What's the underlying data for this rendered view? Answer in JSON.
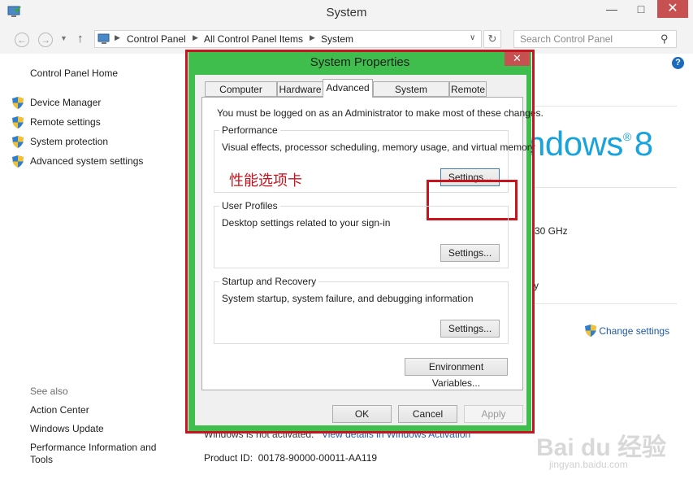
{
  "window": {
    "title": "System"
  },
  "nav": {
    "breadcrumbs": [
      "Control Panel",
      "All Control Panel Items",
      "System"
    ],
    "search_placeholder": "Search Control Panel"
  },
  "sidebar": {
    "home": "Control Panel Home",
    "links": [
      {
        "label": "Device Manager",
        "icon": "shield-icon"
      },
      {
        "label": "Remote settings",
        "icon": "shield-icon"
      },
      {
        "label": "System protection",
        "icon": "shield-icon"
      },
      {
        "label": "Advanced system settings",
        "icon": "shield-icon"
      }
    ],
    "see_also_title": "See also",
    "see_also": [
      "Action Center",
      "Windows Update",
      "Performance Information and Tools"
    ]
  },
  "background": {
    "logo_text": "ndows",
    "logo_number": "8",
    "processor_fragment": "30 GHz",
    "fragment_y": "y",
    "change_settings": "Change settings",
    "activation_text": "Windows is not activated.",
    "activation_link": "View details in Windows Activation",
    "product_id_label": "Product ID:",
    "product_id_value": "00178-90000-00011-AA119",
    "watermark": "Bai du 经验",
    "watermark_sub": "jingyan.baidu.com"
  },
  "dialog": {
    "title": "System Properties",
    "tabs": [
      {
        "label": "Computer Name",
        "active": false
      },
      {
        "label": "Hardware",
        "active": false
      },
      {
        "label": "Advanced",
        "active": true
      },
      {
        "label": "System Protection",
        "active": false
      },
      {
        "label": "Remote",
        "active": false
      }
    ],
    "admin_note": "You must be logged on as an Administrator to make most of these changes.",
    "performance": {
      "title": "Performance",
      "description": "Visual effects, processor scheduling, memory usage, and virtual memory",
      "button": "Settings...",
      "annotation": "性能选项卡"
    },
    "user_profiles": {
      "title": "User Profiles",
      "description": "Desktop settings related to your sign-in",
      "button": "Settings..."
    },
    "startup": {
      "title": "Startup and Recovery",
      "description": "System startup, system failure, and debugging information",
      "button": "Settings..."
    },
    "env_button": "Environment Variables...",
    "ok": "OK",
    "cancel": "Cancel",
    "apply": "Apply"
  },
  "colors": {
    "dialog_frame": "#3fbe4e",
    "annotation_red": "#c8141e",
    "close_red": "#c75050",
    "logo_blue": "#18a3dc"
  }
}
